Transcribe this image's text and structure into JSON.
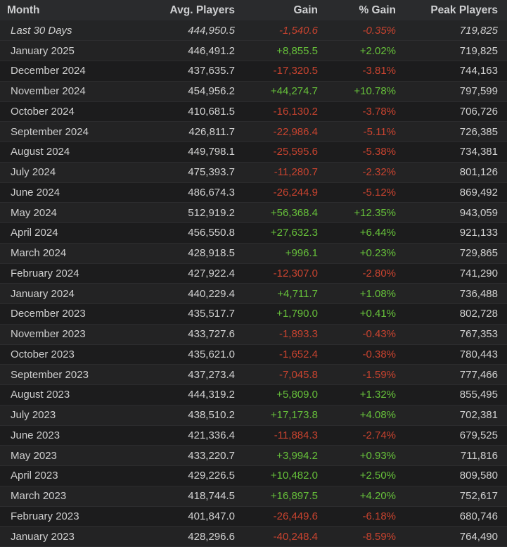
{
  "table": {
    "headers": {
      "month": "Month",
      "avg": "Avg. Players",
      "gain": "Gain",
      "pct": "% Gain",
      "peak": "Peak Players"
    },
    "rows": [
      {
        "month": "Last 30 Days",
        "avg": "444,950.5",
        "gain": "-1,540.6",
        "pct": "-0.35%",
        "peak": "719,825",
        "trend": "down",
        "italic": true
      },
      {
        "month": "January 2025",
        "avg": "446,491.2",
        "gain": "+8,855.5",
        "pct": "+2.02%",
        "peak": "719,825",
        "trend": "up"
      },
      {
        "month": "December 2024",
        "avg": "437,635.7",
        "gain": "-17,320.5",
        "pct": "-3.81%",
        "peak": "744,163",
        "trend": "down"
      },
      {
        "month": "November 2024",
        "avg": "454,956.2",
        "gain": "+44,274.7",
        "pct": "+10.78%",
        "peak": "797,599",
        "trend": "up"
      },
      {
        "month": "October 2024",
        "avg": "410,681.5",
        "gain": "-16,130.2",
        "pct": "-3.78%",
        "peak": "706,726",
        "trend": "down"
      },
      {
        "month": "September 2024",
        "avg": "426,811.7",
        "gain": "-22,986.4",
        "pct": "-5.11%",
        "peak": "726,385",
        "trend": "down"
      },
      {
        "month": "August 2024",
        "avg": "449,798.1",
        "gain": "-25,595.6",
        "pct": "-5.38%",
        "peak": "734,381",
        "trend": "down"
      },
      {
        "month": "July 2024",
        "avg": "475,393.7",
        "gain": "-11,280.7",
        "pct": "-2.32%",
        "peak": "801,126",
        "trend": "down"
      },
      {
        "month": "June 2024",
        "avg": "486,674.3",
        "gain": "-26,244.9",
        "pct": "-5.12%",
        "peak": "869,492",
        "trend": "down"
      },
      {
        "month": "May 2024",
        "avg": "512,919.2",
        "gain": "+56,368.4",
        "pct": "+12.35%",
        "peak": "943,059",
        "trend": "up"
      },
      {
        "month": "April 2024",
        "avg": "456,550.8",
        "gain": "+27,632.3",
        "pct": "+6.44%",
        "peak": "921,133",
        "trend": "up"
      },
      {
        "month": "March 2024",
        "avg": "428,918.5",
        "gain": "+996.1",
        "pct": "+0.23%",
        "peak": "729,865",
        "trend": "up"
      },
      {
        "month": "February 2024",
        "avg": "427,922.4",
        "gain": "-12,307.0",
        "pct": "-2.80%",
        "peak": "741,290",
        "trend": "down"
      },
      {
        "month": "January 2024",
        "avg": "440,229.4",
        "gain": "+4,711.7",
        "pct": "+1.08%",
        "peak": "736,488",
        "trend": "up"
      },
      {
        "month": "December 2023",
        "avg": "435,517.7",
        "gain": "+1,790.0",
        "pct": "+0.41%",
        "peak": "802,728",
        "trend": "up"
      },
      {
        "month": "November 2023",
        "avg": "433,727.6",
        "gain": "-1,893.3",
        "pct": "-0.43%",
        "peak": "767,353",
        "trend": "down"
      },
      {
        "month": "October 2023",
        "avg": "435,621.0",
        "gain": "-1,652.4",
        "pct": "-0.38%",
        "peak": "780,443",
        "trend": "down"
      },
      {
        "month": "September 2023",
        "avg": "437,273.4",
        "gain": "-7,045.8",
        "pct": "-1.59%",
        "peak": "777,466",
        "trend": "down"
      },
      {
        "month": "August 2023",
        "avg": "444,319.2",
        "gain": "+5,809.0",
        "pct": "+1.32%",
        "peak": "855,495",
        "trend": "up"
      },
      {
        "month": "July 2023",
        "avg": "438,510.2",
        "gain": "+17,173.8",
        "pct": "+4.08%",
        "peak": "702,381",
        "trend": "up"
      },
      {
        "month": "June 2023",
        "avg": "421,336.4",
        "gain": "-11,884.3",
        "pct": "-2.74%",
        "peak": "679,525",
        "trend": "down"
      },
      {
        "month": "May 2023",
        "avg": "433,220.7",
        "gain": "+3,994.2",
        "pct": "+0.93%",
        "peak": "711,816",
        "trend": "up"
      },
      {
        "month": "April 2023",
        "avg": "429,226.5",
        "gain": "+10,482.0",
        "pct": "+2.50%",
        "peak": "809,580",
        "trend": "up"
      },
      {
        "month": "March 2023",
        "avg": "418,744.5",
        "gain": "+16,897.5",
        "pct": "+4.20%",
        "peak": "752,617",
        "trend": "up"
      },
      {
        "month": "February 2023",
        "avg": "401,847.0",
        "gain": "-26,449.6",
        "pct": "-6.18%",
        "peak": "680,746",
        "trend": "down"
      },
      {
        "month": "January 2023",
        "avg": "428,296.6",
        "gain": "-40,248.4",
        "pct": "-8.59%",
        "peak": "764,490",
        "trend": "down"
      }
    ]
  },
  "colors": {
    "positive": "#66c03a",
    "negative": "#c8432f",
    "header_bg": "#2a2b2d",
    "row_bg": "#1c1c1d",
    "row_alt_bg": "#232324"
  }
}
